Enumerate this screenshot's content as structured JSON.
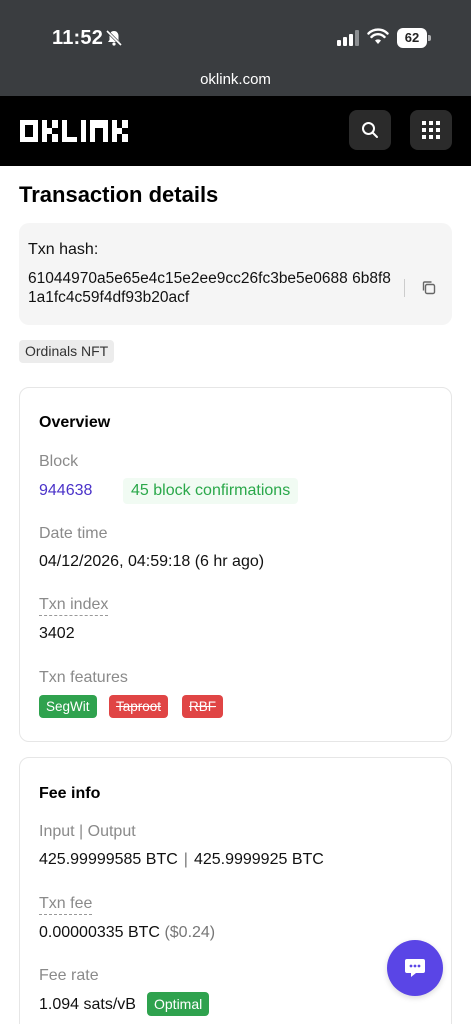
{
  "status_bar": {
    "time": "11:52",
    "battery": "62"
  },
  "browser": {
    "url": "oklink.com"
  },
  "header": {
    "logo_text": "OKLINK"
  },
  "page": {
    "title": "Transaction details"
  },
  "txn": {
    "hash_label": "Txn hash:",
    "hash_value": "61044970a5e65e4c15e2ee9cc26fc3be5e0688 6b8f81a1fc4c59f4df93b20acf",
    "tag": "Ordinals NFT"
  },
  "overview": {
    "title": "Overview",
    "block_label": "Block",
    "block_value": "944638",
    "confirmations": "45 block confirmations",
    "date_label": "Date time",
    "date_value": "04/12/2026, 04:59:18 (6 hr ago)",
    "index_label": "Txn index",
    "index_value": "3402",
    "features_label": "Txn features",
    "features": [
      "SegWit",
      "Taproot",
      "RBF"
    ]
  },
  "fee_info": {
    "title": "Fee info",
    "io_label": "Input | Output",
    "input_value": "425.99999585 BTC",
    "io_sep": "|",
    "output_value": "425.9999925 BTC",
    "fee_label": "Txn fee",
    "fee_btc": "0.00000335 BTC",
    "fee_usd": "($0.24)",
    "rate_label": "Fee rate",
    "rate_value": "1.094 sats/vB",
    "rate_badge": "Optimal"
  },
  "colors": {
    "accent": "#5a45e6",
    "link": "#4a32c9",
    "success": "#2fa24e",
    "danger": "#e04545"
  }
}
